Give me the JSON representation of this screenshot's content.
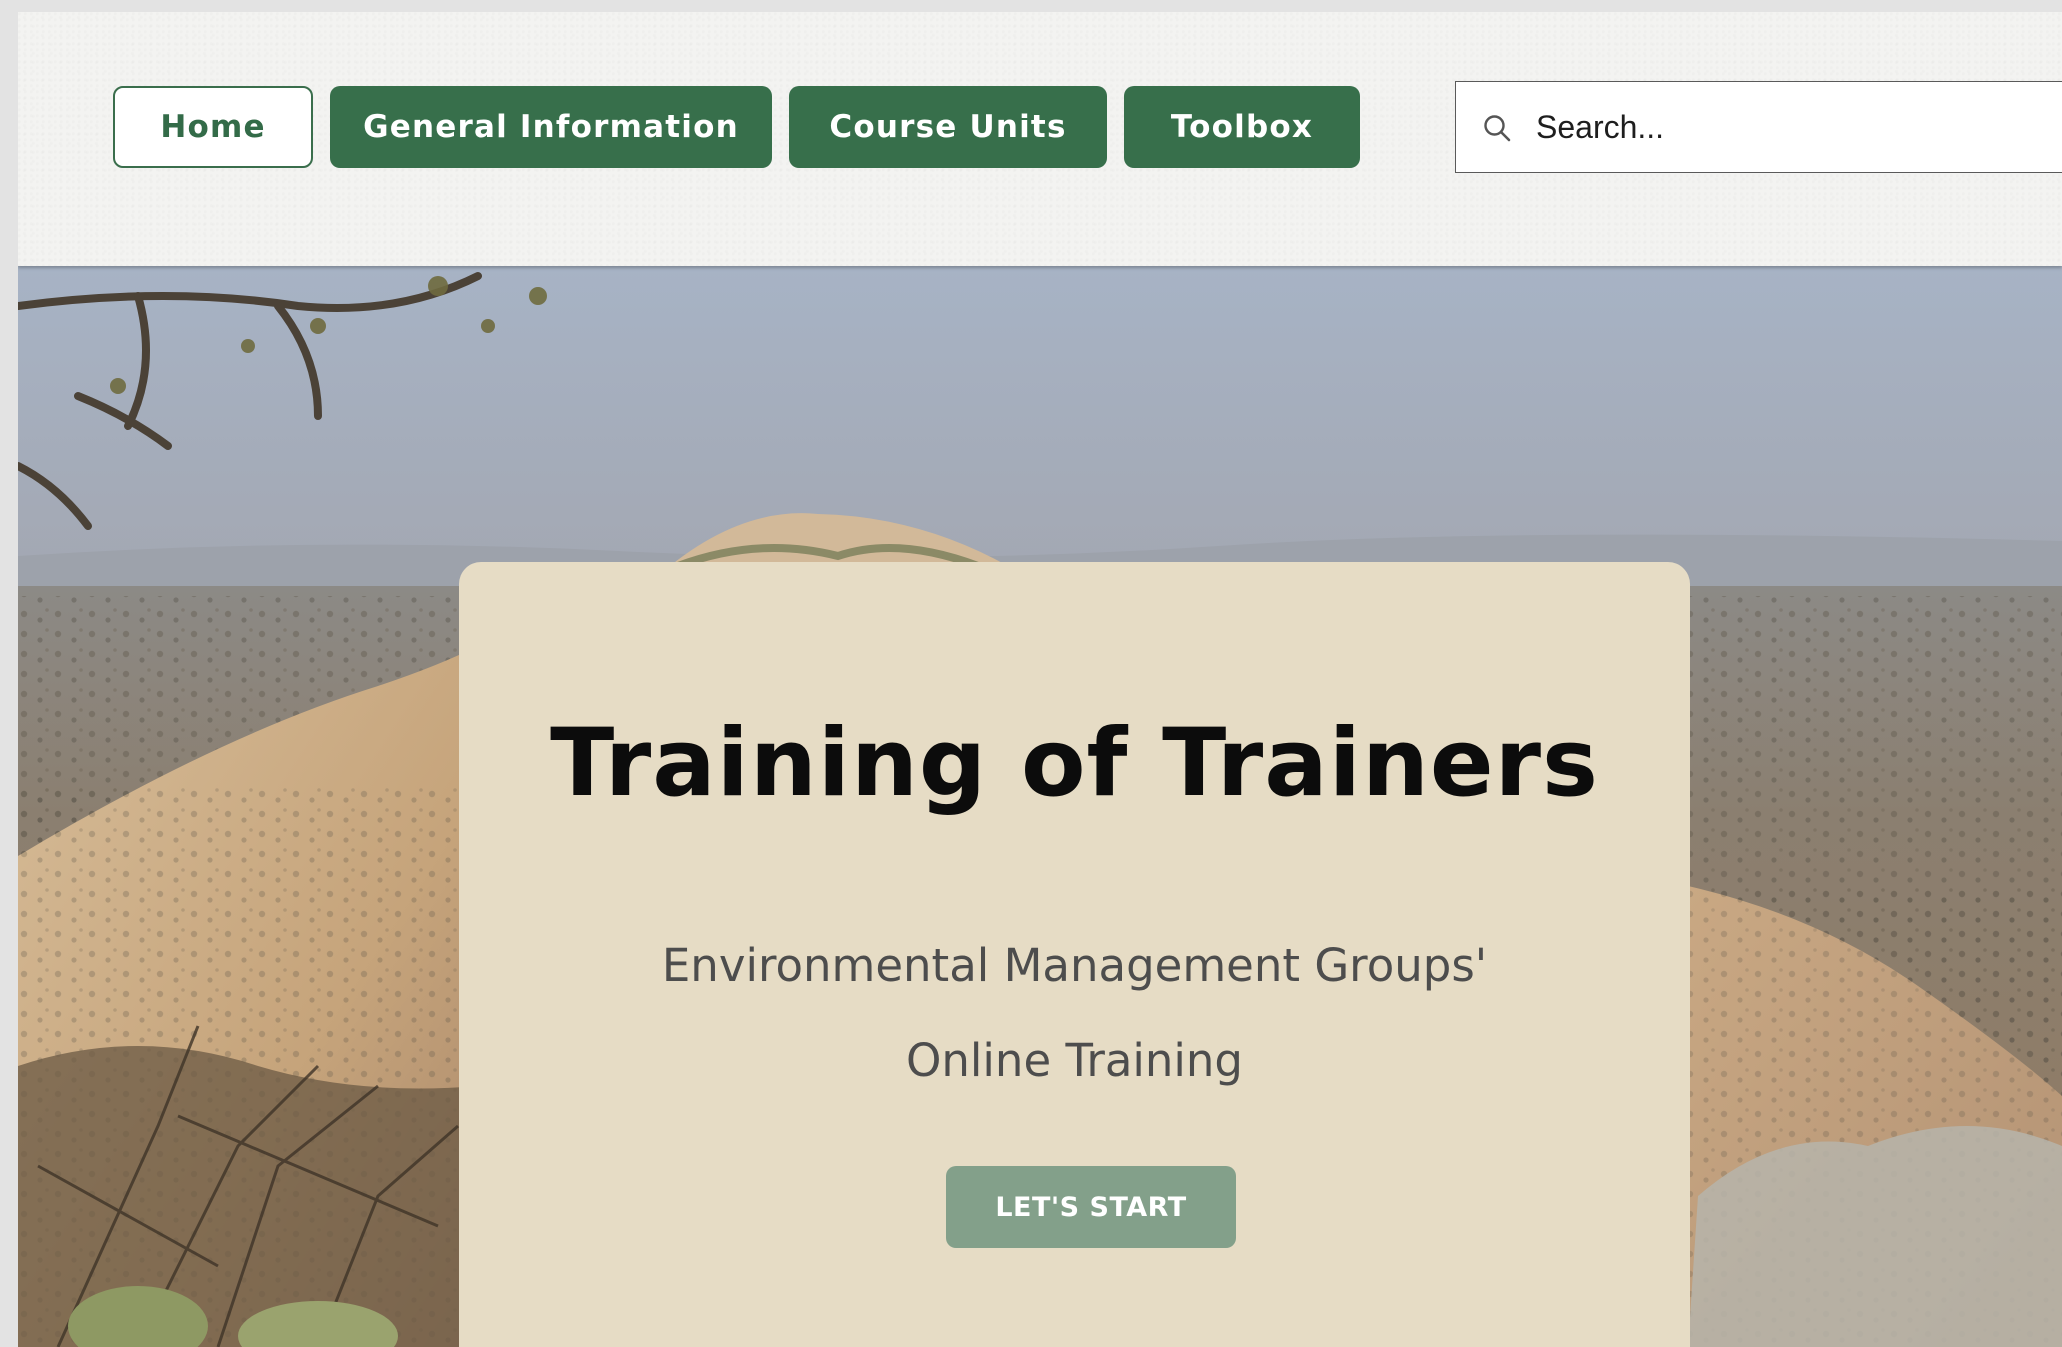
{
  "nav": {
    "items": [
      {
        "label": "Home",
        "active": true
      },
      {
        "label": "General Information",
        "active": false
      },
      {
        "label": "Course Units",
        "active": false
      },
      {
        "label": "Toolbox",
        "active": false
      }
    ]
  },
  "search": {
    "placeholder": "Search...",
    "icon": "search-icon"
  },
  "hero": {
    "title": "Training of Trainers",
    "subtitle_line1": "Environmental Management Groups'",
    "subtitle_line2": "Online Training",
    "cta_label": "LET'S START"
  },
  "colors": {
    "primary_green": "#376f4b",
    "cta_green": "#83a08a",
    "card_beige": "#e6dcc5",
    "header_bg": "#f3f3f1"
  }
}
